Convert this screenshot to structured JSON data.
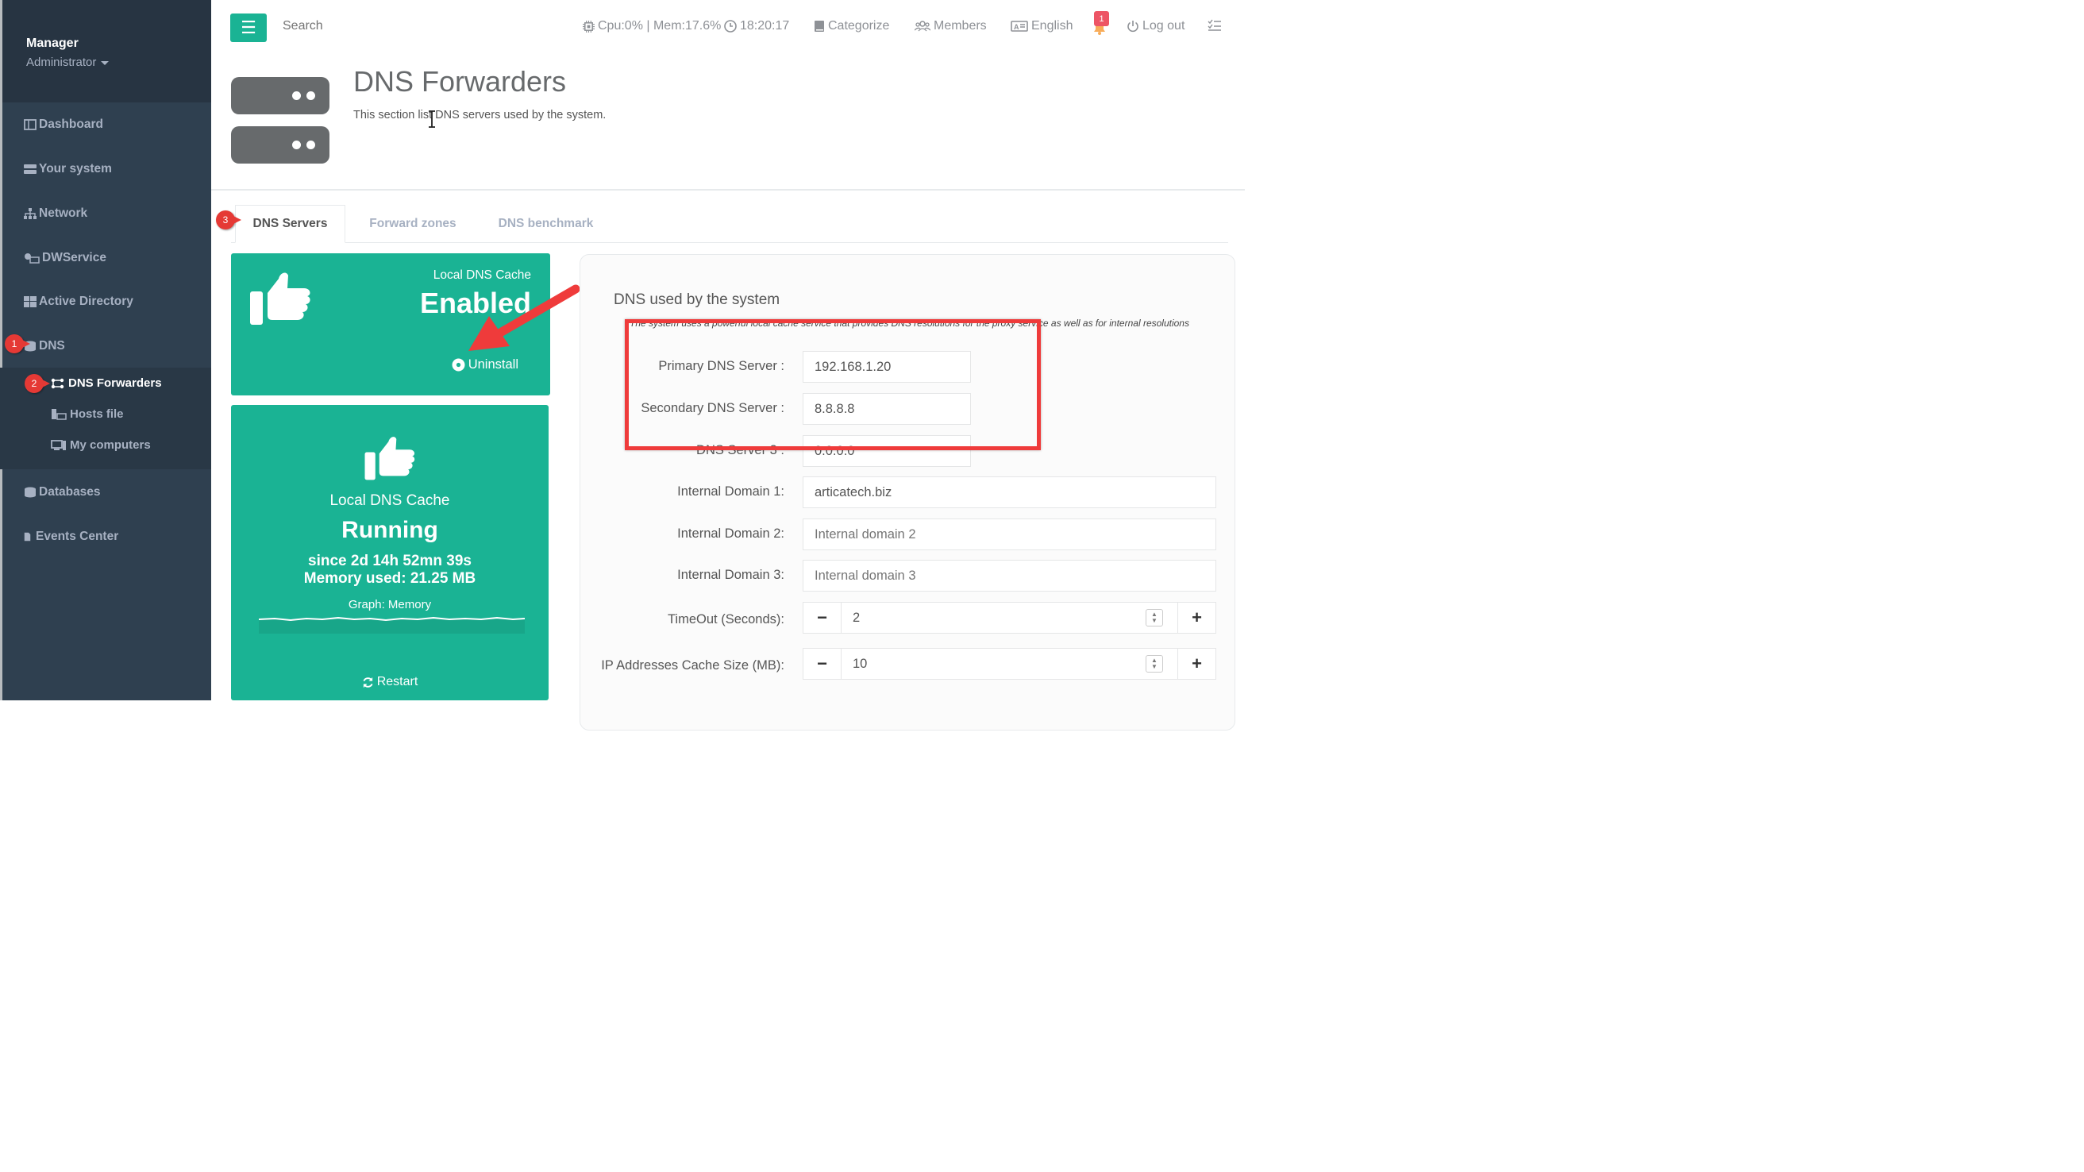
{
  "sidebar": {
    "profile": {
      "name": "Manager",
      "role": "Administrator"
    },
    "items": [
      {
        "label": "Dashboard",
        "icon": "dashboard-icon"
      },
      {
        "label": "Your system",
        "icon": "server-icon"
      },
      {
        "label": "Network",
        "icon": "network-icon"
      },
      {
        "label": "DWService",
        "icon": "dwservice-icon"
      },
      {
        "label": "Active Directory",
        "icon": "windows-icon"
      },
      {
        "label": "DNS",
        "icon": "database-icon"
      },
      {
        "label": "Databases",
        "icon": "database-icon"
      },
      {
        "label": "Events Center",
        "icon": "file-icon"
      }
    ],
    "dns_sub": [
      {
        "label": "DNS Forwarders",
        "icon": "forwarders-icon"
      },
      {
        "label": "Hosts file",
        "icon": "hosts-icon"
      },
      {
        "label": "My computers",
        "icon": "computer-icon"
      }
    ]
  },
  "topbar": {
    "search_placeholder": "Search",
    "status": "Cpu:0% | Mem:17.6%",
    "time": "18:20:17",
    "categorize": "Categorize",
    "members": "Members",
    "language": "English",
    "notif_count": "1",
    "logout": "Log out"
  },
  "header": {
    "title": "DNS Forwarders",
    "description": "This section list DNS servers used by the system."
  },
  "tabs": [
    {
      "label": "DNS Servers",
      "active": true
    },
    {
      "label": "Forward zones",
      "active": false
    },
    {
      "label": "DNS benchmark",
      "active": false
    }
  ],
  "annotations": [
    "1",
    "2",
    "3"
  ],
  "cache_widget": {
    "title": "Local DNS Cache",
    "status": "Enabled",
    "action": "Uninstall"
  },
  "service_widget": {
    "title": "Local DNS Cache",
    "status": "Running",
    "since": "since 2d 14h 52mn 39s",
    "memory": "Memory used: 21.25 MB",
    "graph_label": "Graph: Memory",
    "restart": "Restart"
  },
  "dns_panel": {
    "title": "DNS used by the system",
    "subtitle": "The system uses a powerful local cache service that provides DNS resolutions for the proxy service as well as for internal resolutions",
    "fields": [
      {
        "label": "Primary DNS Server :",
        "value": "192.168.1.20"
      },
      {
        "label": "Secondary DNS Server :",
        "value": "8.8.8.8"
      },
      {
        "label": "DNS Server 3 :",
        "value": "0.0.0.0"
      },
      {
        "label": "Internal Domain 1:",
        "value": "articatech.biz"
      },
      {
        "label": "Internal Domain 2:",
        "placeholder": "Internal domain 2"
      },
      {
        "label": "Internal Domain 3:",
        "placeholder": "Internal domain 3"
      }
    ],
    "timeout": {
      "label": "TimeOut (Seconds):",
      "value": "2"
    },
    "cache_size": {
      "label": "IP Addresses Cache Size (MB):",
      "value": "10"
    }
  },
  "colors": {
    "accent": "#1ab394",
    "sidebar": "#2f4050",
    "annotation": "#ef3b3b"
  }
}
